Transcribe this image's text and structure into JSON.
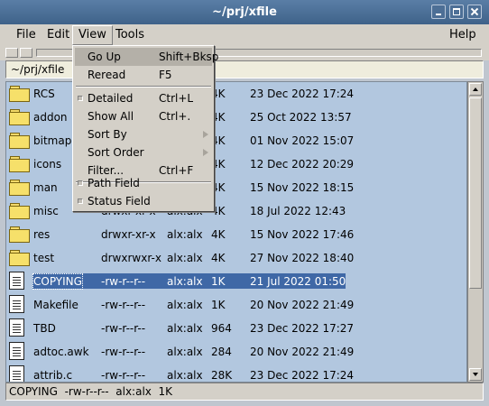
{
  "window": {
    "title": "~/prj/xfile"
  },
  "menubar": {
    "file": "File",
    "edit": "Edit",
    "view": "View",
    "tools": "Tools",
    "help": "Help"
  },
  "path": "~/prj/xfile",
  "view_menu": {
    "go_up": "Go Up",
    "go_up_acc": "Shift+Bksp",
    "reread": "Reread",
    "reread_acc": "F5",
    "detailed": "Detailed",
    "detailed_acc": "Ctrl+L",
    "show_all": "Show All",
    "show_all_acc": "Ctrl+.",
    "sort_by": "Sort By",
    "sort_order": "Sort Order",
    "filter": "Filter...",
    "filter_acc": "Ctrl+F",
    "path_field": "Path Field",
    "status_field": "Status Field"
  },
  "files": [
    {
      "icon": "folder",
      "name": "RCS",
      "perm": "",
      "owner": "",
      "size": "4K",
      "date": "23 Dec 2022 17:24"
    },
    {
      "icon": "folder",
      "name": "addon",
      "perm": "",
      "owner": "",
      "size": "4K",
      "date": "25 Oct 2022 13:57"
    },
    {
      "icon": "folder",
      "name": "bitmaps",
      "perm": "",
      "owner": "",
      "size": "4K",
      "date": "01 Nov 2022 15:07"
    },
    {
      "icon": "folder",
      "name": "icons",
      "perm": "",
      "owner": "",
      "size": "4K",
      "date": "12 Dec 2022 20:29"
    },
    {
      "icon": "folder",
      "name": "man",
      "perm": "",
      "owner": "",
      "size": "4K",
      "date": "15 Nov 2022 18:15"
    },
    {
      "icon": "folder",
      "name": "misc",
      "perm": "drwxr-xr-x",
      "owner": "alx:alx",
      "size": "4K",
      "date": "18 Jul 2022 12:43"
    },
    {
      "icon": "folder",
      "name": "res",
      "perm": "drwxr-xr-x",
      "owner": "alx:alx",
      "size": "4K",
      "date": "15 Nov 2022 17:46"
    },
    {
      "icon": "folder",
      "name": "test",
      "perm": "drwxrwxr-x",
      "owner": "alx:alx",
      "size": "4K",
      "date": "27 Nov 2022 18:40"
    },
    {
      "icon": "document",
      "name": "COPYING",
      "perm": "-rw-r--r--",
      "owner": "alx:alx",
      "size": "1K",
      "date": "21 Jul 2022 01:50",
      "selected": true
    },
    {
      "icon": "document",
      "name": "Makefile",
      "perm": "-rw-r--r--",
      "owner": "alx:alx",
      "size": "1K",
      "date": "20 Nov 2022 21:49"
    },
    {
      "icon": "document",
      "name": "TBD",
      "perm": "-rw-r--r--",
      "owner": "alx:alx",
      "size": "964",
      "date": "23 Dec 2022 17:27"
    },
    {
      "icon": "document",
      "name": "adtoc.awk",
      "perm": "-rw-r--r--",
      "owner": "alx:alx",
      "size": "284",
      "date": "20 Nov 2022 21:49"
    },
    {
      "icon": "document",
      "name": "attrib.c",
      "perm": "-rw-r--r--",
      "owner": "alx:alx",
      "size": "28K",
      "date": "23 Dec 2022 17:24"
    }
  ],
  "status": "COPYING  -rw-r--r--  alx:alx  1K"
}
